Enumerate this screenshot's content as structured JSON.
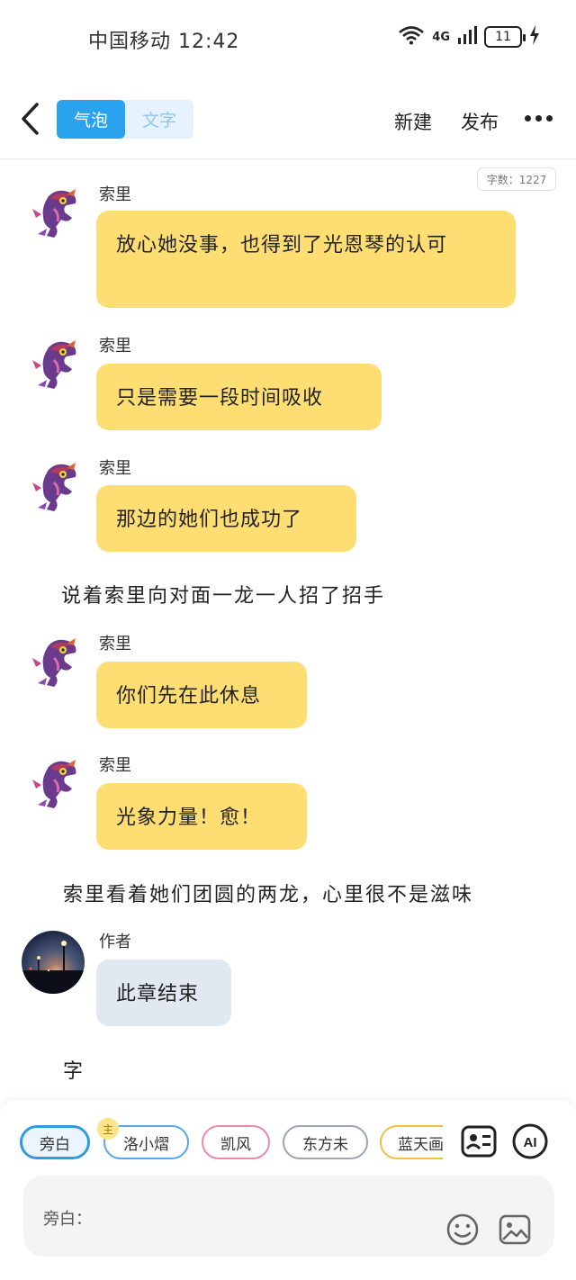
{
  "status": {
    "carrier": "中国移动 12:42",
    "network": "4G",
    "battery": "11"
  },
  "header": {
    "tabs": [
      "气泡",
      "文字"
    ],
    "new_label": "新建",
    "publish_label": "发布"
  },
  "word_count": "字数：1227",
  "messages": [
    {
      "sender": "索里",
      "text": "放心她没事，也得到了光恩琴的认可"
    },
    {
      "sender": "索里",
      "text": "只是需要一段时间吸收"
    },
    {
      "sender": "索里",
      "text": "那边的她们也成功了"
    },
    {
      "narration": "说着索里向对面一龙一人招了招手"
    },
    {
      "sender": "索里",
      "text": "你们先在此休息"
    },
    {
      "sender": "索里",
      "text": "光象力量！愈！"
    },
    {
      "narration": "索里看着她们团圆的两龙，心里很不是滋味"
    },
    {
      "sender": "作者",
      "text": "此章结束"
    },
    {
      "narration": "字"
    }
  ],
  "composer": {
    "chips": [
      "旁白",
      "洛小熠",
      "凯风",
      "东方未",
      "蓝天画"
    ],
    "chip_colors": [
      "#2e9ae0",
      "#5aa7e6",
      "#e98aa8",
      "#9aa6b8",
      "#f0c040"
    ],
    "main_badge": "主",
    "input_placeholder": "旁白："
  }
}
